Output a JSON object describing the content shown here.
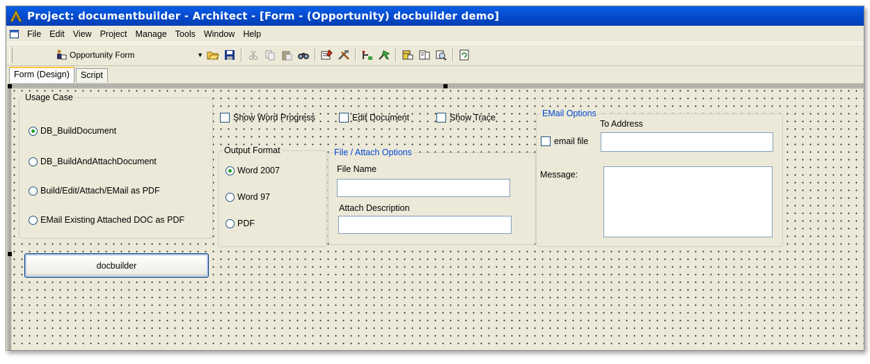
{
  "window": {
    "title": "Project: documentbuilder - Architect - [Form - (Opportunity) docbuilder demo]"
  },
  "menu": [
    "File",
    "Edit",
    "View",
    "Project",
    "Manage",
    "Tools",
    "Window",
    "Help"
  ],
  "toolbar": {
    "form_selector": "Opportunity Form",
    "buttons": [
      "open-icon",
      "save-icon",
      "cut-icon",
      "copy-icon",
      "paste-icon",
      "find-icon",
      "properties-icon",
      "tools-icon",
      "tab-order-icon",
      "run-icon",
      "database-icon",
      "list-icon",
      "lookup-icon",
      "refresh-icon"
    ]
  },
  "tabs": [
    {
      "label": "Form (Design)",
      "active": true
    },
    {
      "label": "Script",
      "active": false
    }
  ],
  "form": {
    "usage_case": {
      "legend": "Usage Case",
      "options": [
        {
          "label": "DB_BuildDocument",
          "checked": true
        },
        {
          "label": "DB_BuildAndAttachDocument",
          "checked": false
        },
        {
          "label": "Build/Edit/Attach/EMail as PDF",
          "checked": false
        },
        {
          "label": "EMail Existing Attached DOC as PDF",
          "checked": false
        }
      ]
    },
    "checkboxes": {
      "show_word_progress": "Show Word Progress",
      "edit_document": "Edit Document",
      "show_trace": "Show Trace"
    },
    "output_format": {
      "legend": "Output Format",
      "options": [
        {
          "label": "Word 2007",
          "checked": true
        },
        {
          "label": "Word 97",
          "checked": false
        },
        {
          "label": "PDF",
          "checked": false
        }
      ]
    },
    "file_attach": {
      "legend": "File / Attach Options",
      "file_name_label": "File Name",
      "file_name_value": "",
      "attach_description_label": "Attach Description",
      "attach_description_value": ""
    },
    "email": {
      "legend": "EMail Options",
      "to_address_label": "To Address",
      "to_address_value": "",
      "email_file_label": "email file",
      "message_label": "Message:",
      "message_value": ""
    },
    "docbuilder_button": "docbuilder"
  }
}
